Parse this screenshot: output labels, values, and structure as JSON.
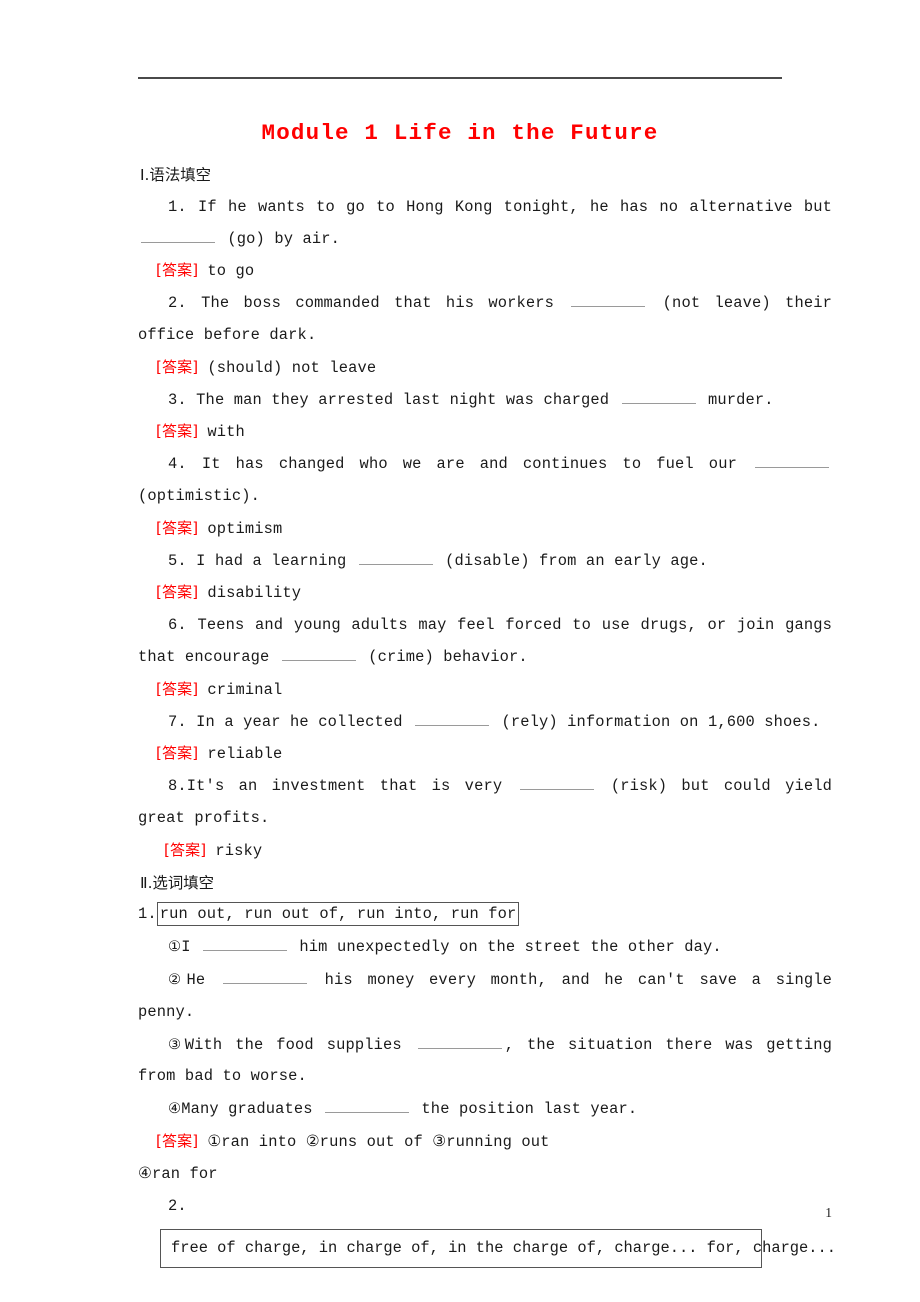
{
  "document": {
    "title": "Module 1 Life in the Future",
    "title_color": "#ff0000",
    "page_number": "1",
    "answer_label": "[答案]"
  },
  "sections": [
    {
      "heading": "Ⅰ.语法填空",
      "items": [
        {
          "number": "1.",
          "text_before": "If he wants to go to Hong Kong tonight, he has no alternative but",
          "text_after": "(go) by air.",
          "answer": "to go"
        },
        {
          "number": "2.",
          "text_before": "The boss commanded that his workers",
          "text_after": "(not leave) their office before dark.",
          "answer": "(should) not leave"
        },
        {
          "number": "3.",
          "text_before": "The man they arrested last night was charged",
          "text_after": "murder.",
          "answer": "with"
        },
        {
          "number": "4.",
          "text_before": "It has changed who we are and continues to fuel our",
          "text_after": "(optimistic).",
          "answer": "optimism"
        },
        {
          "number": "5.",
          "text_before": "I had a learning",
          "text_after": "(disable) from an early age.",
          "answer": "disability"
        },
        {
          "number": "6.",
          "text_before": "Teens and young adults may feel forced to use drugs, or join gangs that encourage",
          "text_after": "(crime) behavior.",
          "answer": "criminal"
        },
        {
          "number": "7.",
          "text_before": "In a year he collected",
          "text_after": "(rely) information on 1,600 shoes.",
          "answer": "reliable"
        },
        {
          "number": "8.",
          "text_before": "It's an investment that is very",
          "text_after": "(risk) but could yield great profits.",
          "answer": "risky"
        }
      ]
    },
    {
      "heading": "Ⅱ.选词填空",
      "groups": [
        {
          "number": "1.",
          "word_bank": "run out,  run out of,  run into,  run for",
          "questions": [
            {
              "marker": "①",
              "text_before": "I",
              "text_after": "him unexpectedly on the street the other day."
            },
            {
              "marker": "②",
              "text_before": "He",
              "text_after": "his money every month, and he can't save a single penny."
            },
            {
              "marker": "③",
              "text_before": "With the food supplies",
              "text_after": ",  the situation there was getting from bad to worse."
            },
            {
              "marker": "④",
              "text_before": "Many graduates",
              "text_after": "the position last year."
            }
          ],
          "answer_line1": "①ran into  ②runs out of  ③running out",
          "answer_line2": "④ran for"
        },
        {
          "number": "2.",
          "word_bank": "free of charge, in charge of, in the charge of, charge... for, charge..."
        }
      ]
    }
  ]
}
